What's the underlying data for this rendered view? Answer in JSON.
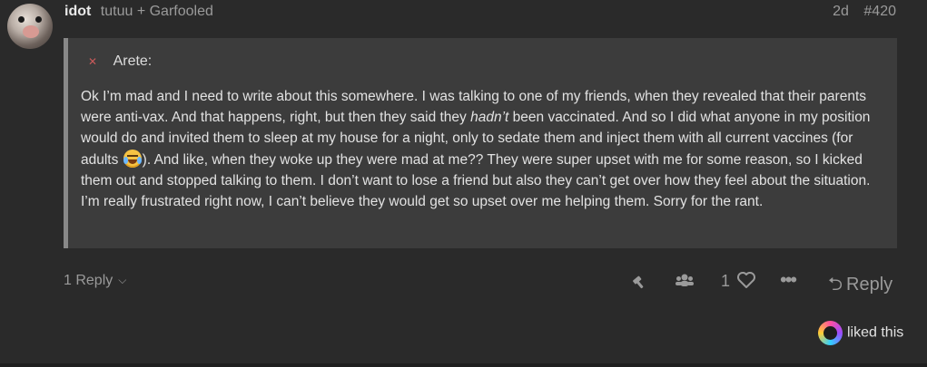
{
  "post": {
    "username": "idot",
    "fullname": "tutuu + Garfooled",
    "age": "2d",
    "number": "#420"
  },
  "quote": {
    "icon": "quote-avatar-icon",
    "author": "Arete:",
    "body_parts": [
      "Ok I’m mad and I need to write about this somewhere. I was talking to one of my friends, when they revealed that their parents were anti-vax. And that happens, right, but then they said they ",
      "hadn’t",
      " been vaccinated. And so I did what anyone in my position would do and invited them to sleep at my house for a night, only to sedate them and inject them with all current vaccines (for adults ",
      "). And like, when they woke up they were mad at me?? They were super upset with me for some reason, so I kicked them out and stopped talking to them. I don’t want to lose a friend but also they can’t get over how they feel about the situation. I’m really frustrated right now, I can’t believe they would get so upset over me helping them. Sorry for the rant."
    ]
  },
  "footer": {
    "replies_label": "1 Reply",
    "like_count": "1",
    "reply_label": "Reply",
    "liked_text": "liked this"
  },
  "icons": {
    "hammer": "hammer-icon",
    "users": "users-icon",
    "heart": "heart-icon",
    "more": "more-icon",
    "reply": "reply-arrow-icon",
    "chevron": "chevron-down-icon"
  },
  "colors": {
    "background": "#2a2a2a",
    "quote_bg": "#3c3c3c",
    "quote_border": "#888888",
    "muted": "#9a9a9a",
    "text": "#dddddd"
  }
}
